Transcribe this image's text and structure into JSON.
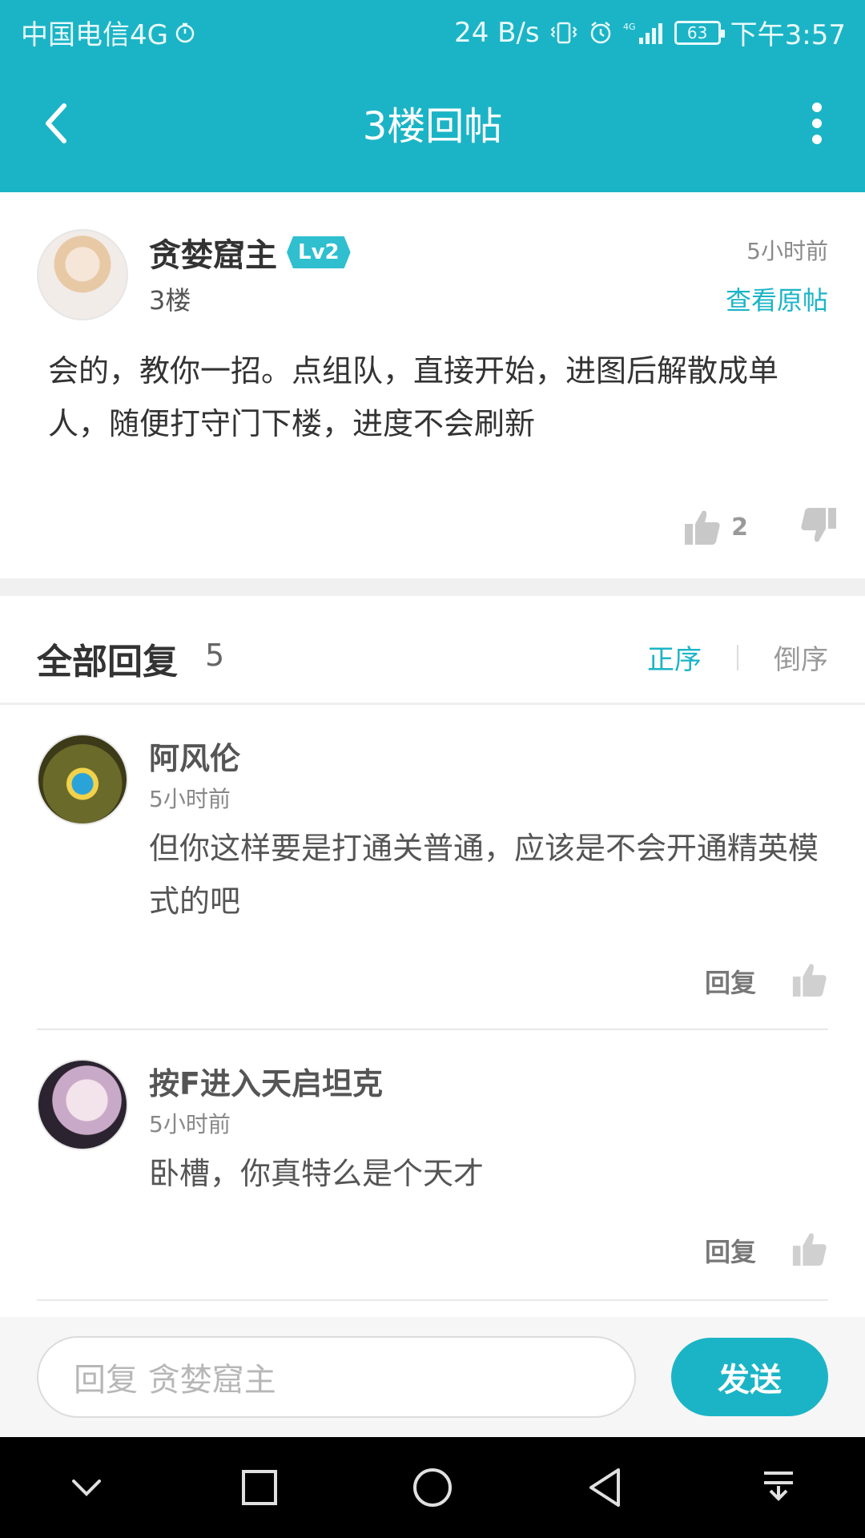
{
  "status_bar": {
    "carrier": "中国电信4G",
    "net_speed": "24 B/s",
    "network": "4G",
    "battery": "63",
    "time": "下午3:57"
  },
  "nav": {
    "title": "3楼回帖",
    "back_icon": "chevron-left-icon",
    "more_icon": "more-vertical-icon"
  },
  "post": {
    "author": "贪婪窟主",
    "level": "Lv2",
    "floor": "3楼",
    "time": "5小时前",
    "view_original": "查看原帖",
    "content": "会的，教你一招。点组队，直接开始，进图后解散成单人，随便打守门下楼，进度不会刷新",
    "likes": "2"
  },
  "replies_header": {
    "title": "全部回复",
    "count": "5",
    "sort_asc": "正序",
    "sort_desc": "倒序"
  },
  "replies": [
    {
      "name": "阿风伦",
      "time": "5小时前",
      "text": "但你这样要是打通关普通，应该是不会开通精英模式的吧",
      "reply_label": "回复"
    },
    {
      "name": "按F进入天启坦克",
      "time": "5小时前",
      "text": "卧槽，你真特么是个天才",
      "reply_label": "回复"
    }
  ],
  "input": {
    "placeholder": "回复 贪婪窟主",
    "send_label": "发送"
  },
  "colors": {
    "accent": "#1bb4c6",
    "text": "#333333",
    "muted": "#999999"
  }
}
